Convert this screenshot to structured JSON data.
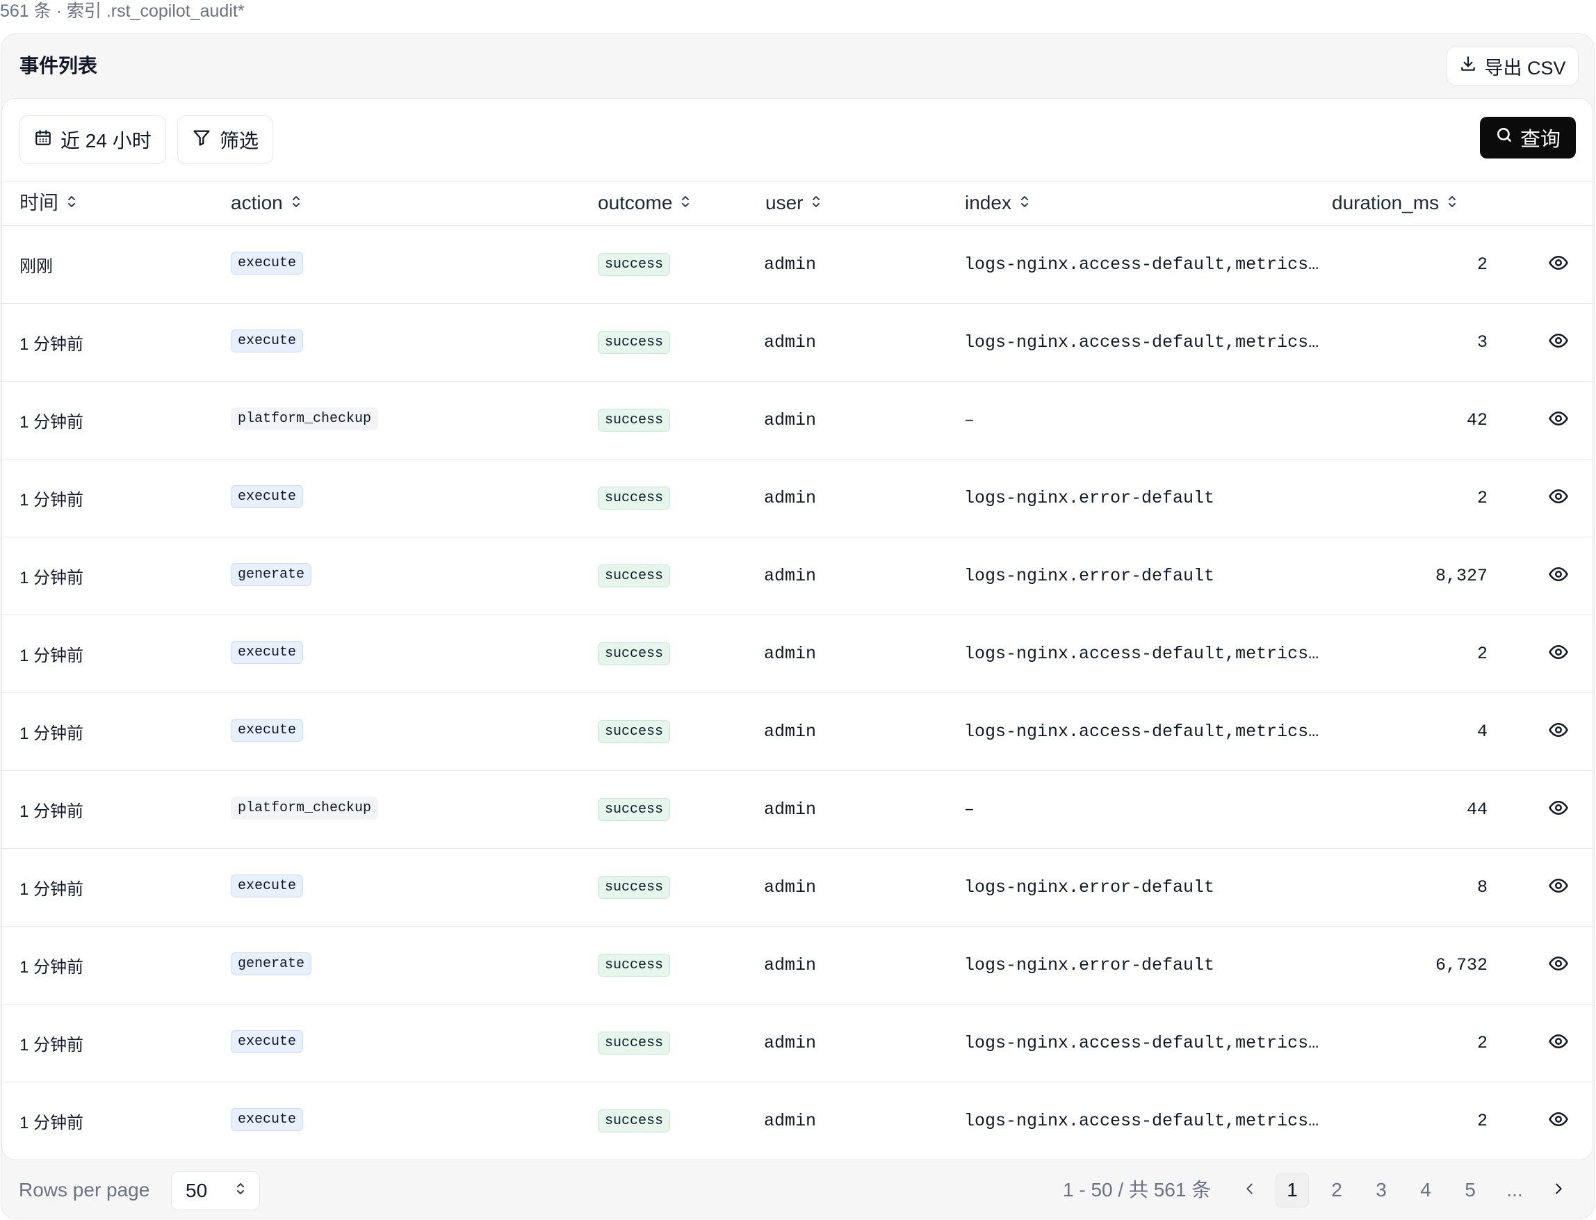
{
  "subtitle": "561 条 · 索引 .rst_copilot_audit*",
  "header": {
    "title": "事件列表",
    "export_label": "导出 CSV"
  },
  "toolbar": {
    "time_range": "近 24 小时",
    "filter_label": "筛选",
    "query_label": "查询"
  },
  "columns": [
    "时间",
    "action",
    "outcome",
    "user",
    "index",
    "duration_ms"
  ],
  "rows": [
    {
      "time": "刚刚",
      "action": "execute",
      "outcome": "success",
      "user": "admin",
      "index": "logs-nginx.access-default,metrics…",
      "duration": "2"
    },
    {
      "time": "1 分钟前",
      "action": "execute",
      "outcome": "success",
      "user": "admin",
      "index": "logs-nginx.access-default,metrics…",
      "duration": "3"
    },
    {
      "time": "1 分钟前",
      "action": "platform_checkup",
      "outcome": "success",
      "user": "admin",
      "index": "–",
      "duration": "42"
    },
    {
      "time": "1 分钟前",
      "action": "execute",
      "outcome": "success",
      "user": "admin",
      "index": "logs-nginx.error-default",
      "duration": "2"
    },
    {
      "time": "1 分钟前",
      "action": "generate",
      "outcome": "success",
      "user": "admin",
      "index": "logs-nginx.error-default",
      "duration": "8,327"
    },
    {
      "time": "1 分钟前",
      "action": "execute",
      "outcome": "success",
      "user": "admin",
      "index": "logs-nginx.access-default,metrics…",
      "duration": "2"
    },
    {
      "time": "1 分钟前",
      "action": "execute",
      "outcome": "success",
      "user": "admin",
      "index": "logs-nginx.access-default,metrics…",
      "duration": "4"
    },
    {
      "time": "1 分钟前",
      "action": "platform_checkup",
      "outcome": "success",
      "user": "admin",
      "index": "–",
      "duration": "44"
    },
    {
      "time": "1 分钟前",
      "action": "execute",
      "outcome": "success",
      "user": "admin",
      "index": "logs-nginx.error-default",
      "duration": "8"
    },
    {
      "time": "1 分钟前",
      "action": "generate",
      "outcome": "success",
      "user": "admin",
      "index": "logs-nginx.error-default",
      "duration": "6,732"
    },
    {
      "time": "1 分钟前",
      "action": "execute",
      "outcome": "success",
      "user": "admin",
      "index": "logs-nginx.access-default,metrics…",
      "duration": "2"
    },
    {
      "time": "1 分钟前",
      "action": "execute",
      "outcome": "success",
      "user": "admin",
      "index": "logs-nginx.access-default,metrics…",
      "duration": "2"
    }
  ],
  "footer": {
    "rows_per_page_label": "Rows per page",
    "rows_per_page_value": "50",
    "range_text": "1 - 50 / 共 561 条",
    "pages": [
      "1",
      "2",
      "3",
      "4",
      "5"
    ],
    "ellipsis": "...",
    "current_page": "1"
  },
  "icons": {
    "export": "download-icon",
    "time": "calendar-icon",
    "filter": "funnel-icon",
    "query": "search-icon",
    "sort": "sort-icon",
    "row_view": "eye-icon",
    "select": "chevron-updown-icon",
    "prev": "chevron-left-icon",
    "next": "chevron-right-icon"
  },
  "colors": {
    "action_tag_blue": "#e8f0fd",
    "outcome_success": "#e6f6ec",
    "primary_button": "#0b0b0b"
  }
}
